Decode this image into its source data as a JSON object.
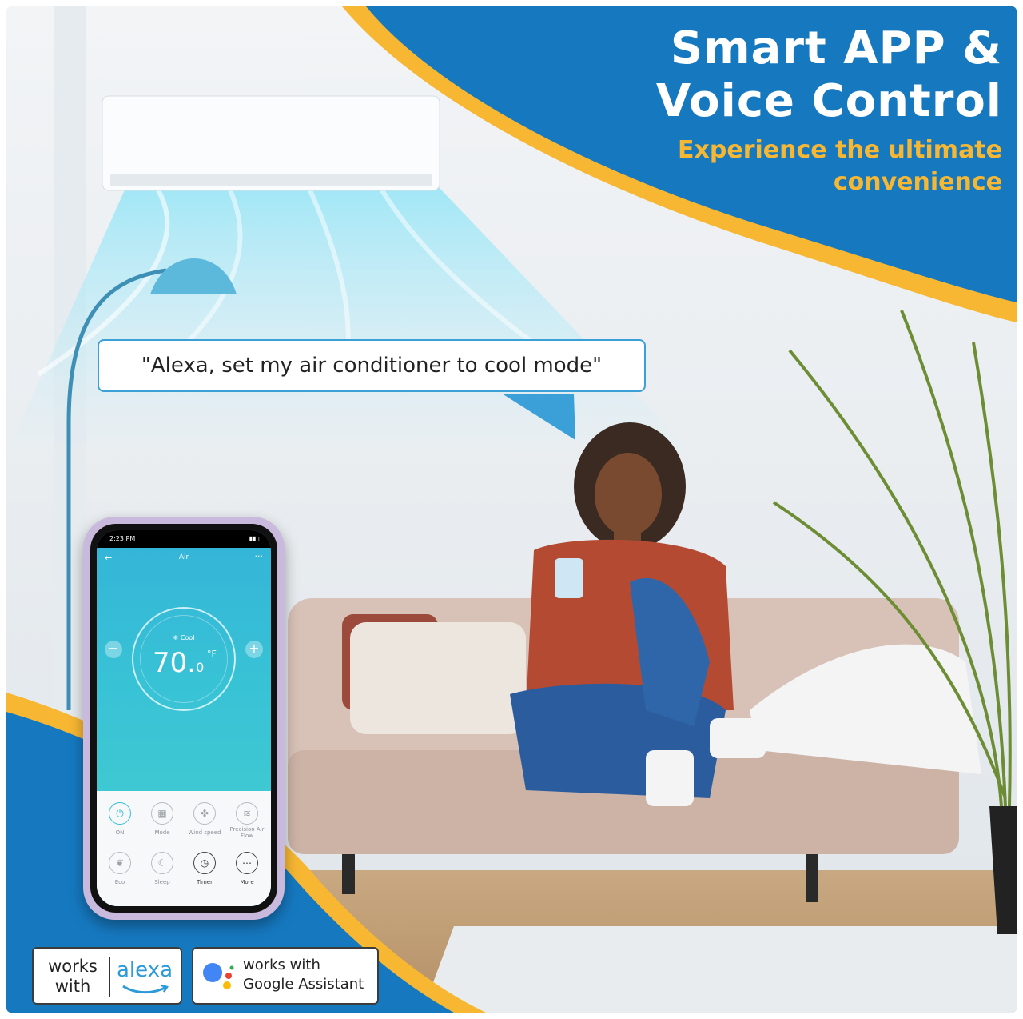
{
  "headline": {
    "line1": "Smart APP &",
    "line2": "Voice Control",
    "subline1": "Experience the ultimate",
    "subline2": "convenience"
  },
  "speech_bubble": "\"Alexa, set my air conditioner to cool mode\"",
  "colors": {
    "brand_blue": "#1679c0",
    "accent_yellow": "#f7b733",
    "bubble_border": "#3ba0d8",
    "app_teal": "#38c2d6"
  },
  "phone": {
    "status_time": "2:23 PM",
    "app_title": "Air",
    "mode_label": "Cool",
    "temperature_main": "70.",
    "temperature_decimal": "0",
    "unit": "°F",
    "controls": [
      {
        "label": "ON",
        "icon": "power-icon"
      },
      {
        "label": "Mode",
        "icon": "mode-grid-icon"
      },
      {
        "label": "Wind speed",
        "icon": "fan-icon"
      },
      {
        "label": "Precision Air Flow",
        "icon": "airflow-icon"
      },
      {
        "label": "Eco",
        "icon": "leaf-icon"
      },
      {
        "label": "Sleep",
        "icon": "moon-icon"
      },
      {
        "label": "Timer",
        "icon": "timer-icon"
      },
      {
        "label": "More",
        "icon": "more-dots-icon"
      }
    ]
  },
  "badges": {
    "alexa_works": "works",
    "alexa_with": "with",
    "alexa_brand": "alexa",
    "google_line1": "works with",
    "google_line2": "Google Assistant"
  }
}
